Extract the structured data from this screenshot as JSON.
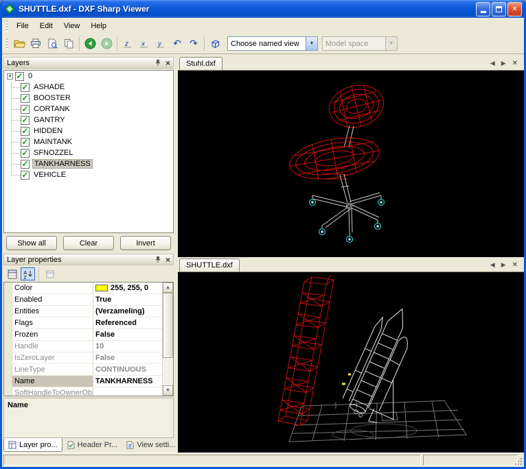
{
  "window": {
    "title": "SHUTTLE.dxf - DXF Sharp Viewer"
  },
  "menu": {
    "items": [
      "File",
      "Edit",
      "View",
      "Help"
    ]
  },
  "toolbar": {
    "named_view_value": "Choose named view",
    "space_value": "Model space",
    "axis_labels": [
      "z",
      "x",
      "y"
    ]
  },
  "layers_panel": {
    "title": "Layers",
    "items": [
      {
        "label": "0",
        "checked": true,
        "expandable": true
      },
      {
        "label": "ASHADE",
        "checked": true
      },
      {
        "label": "BOOSTER",
        "checked": true
      },
      {
        "label": "CORTANK",
        "checked": true
      },
      {
        "label": "GANTRY",
        "checked": true
      },
      {
        "label": "HIDDEN",
        "checked": true
      },
      {
        "label": "MAINTANK",
        "checked": true
      },
      {
        "label": "SFNOZZEL",
        "checked": true
      },
      {
        "label": "TANKHARNESS",
        "checked": true,
        "selected": true
      },
      {
        "label": "VEHICLE",
        "checked": true
      }
    ],
    "buttons": [
      "Show all",
      "Clear",
      "Invert"
    ]
  },
  "properties_panel": {
    "title": "Layer properties",
    "rows": [
      {
        "name": "Color",
        "value": "255, 255, 0",
        "swatch": "#ffff00"
      },
      {
        "name": "Enabled",
        "value": "True"
      },
      {
        "name": "Entities",
        "value": "(Verzameling)"
      },
      {
        "name": "Flags",
        "value": "Referenced"
      },
      {
        "name": "Frozen",
        "value": "False"
      },
      {
        "name": "Handle",
        "value": "10",
        "readonly": true
      },
      {
        "name": "IsZeroLayer",
        "value": "False",
        "readonly": true
      },
      {
        "name": "LineType",
        "value": "CONTINUOUS",
        "readonly": true
      },
      {
        "name": "Name",
        "value": "TANKHARNESS",
        "selected": true
      },
      {
        "name": "SoftHandleToOwnerObj",
        "value": "",
        "readonly": true
      }
    ],
    "description_title": "Name",
    "tabs": [
      "Layer pro...",
      "Header Pr...",
      "View setti..."
    ]
  },
  "documents": [
    {
      "tab": "Stuhl.dxf"
    },
    {
      "tab": "SHUTTLE.dxf"
    }
  ],
  "icons": {
    "expander": "+",
    "check": "✓",
    "panel_close": "×",
    "prev": "◀",
    "next": "▶",
    "doc_close": "✕",
    "window_close": "✕",
    "rotate_ccw": "↶",
    "rotate_cw": "↷",
    "dropdown": "▼",
    "scroll_up": "▲",
    "scroll_down": "▼"
  },
  "colors": {
    "selection_inactive": "#ccc9bb",
    "layer_color_swatch": "#ffff00"
  }
}
